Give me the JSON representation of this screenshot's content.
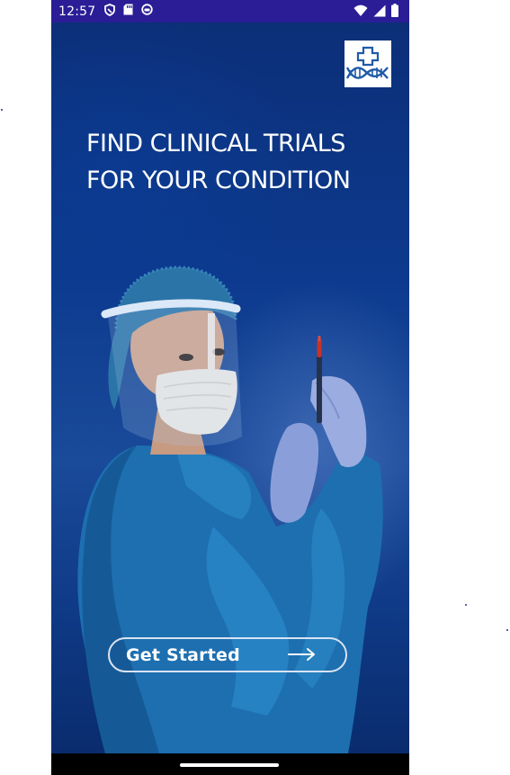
{
  "status_bar": {
    "time": "12:57",
    "left_icons": [
      "shield-icon",
      "sd-card-icon",
      "sync-icon"
    ],
    "right_icons": [
      "wifi-icon",
      "signal-icon",
      "battery-icon"
    ]
  },
  "logo": {
    "icon": "cross-dna-logo-icon",
    "color": "#1f5aa8"
  },
  "headline": {
    "line1": "FIND CLINICAL TRIALS",
    "line2": "FOR YOUR CONDITION"
  },
  "cta": {
    "label": "Get Started",
    "icon": "arrow-right-icon"
  },
  "colors": {
    "status_bar": "#2a1d96",
    "background": "#0d3a8e",
    "text": "#ffffff",
    "button_border": "#d9e3f3"
  }
}
